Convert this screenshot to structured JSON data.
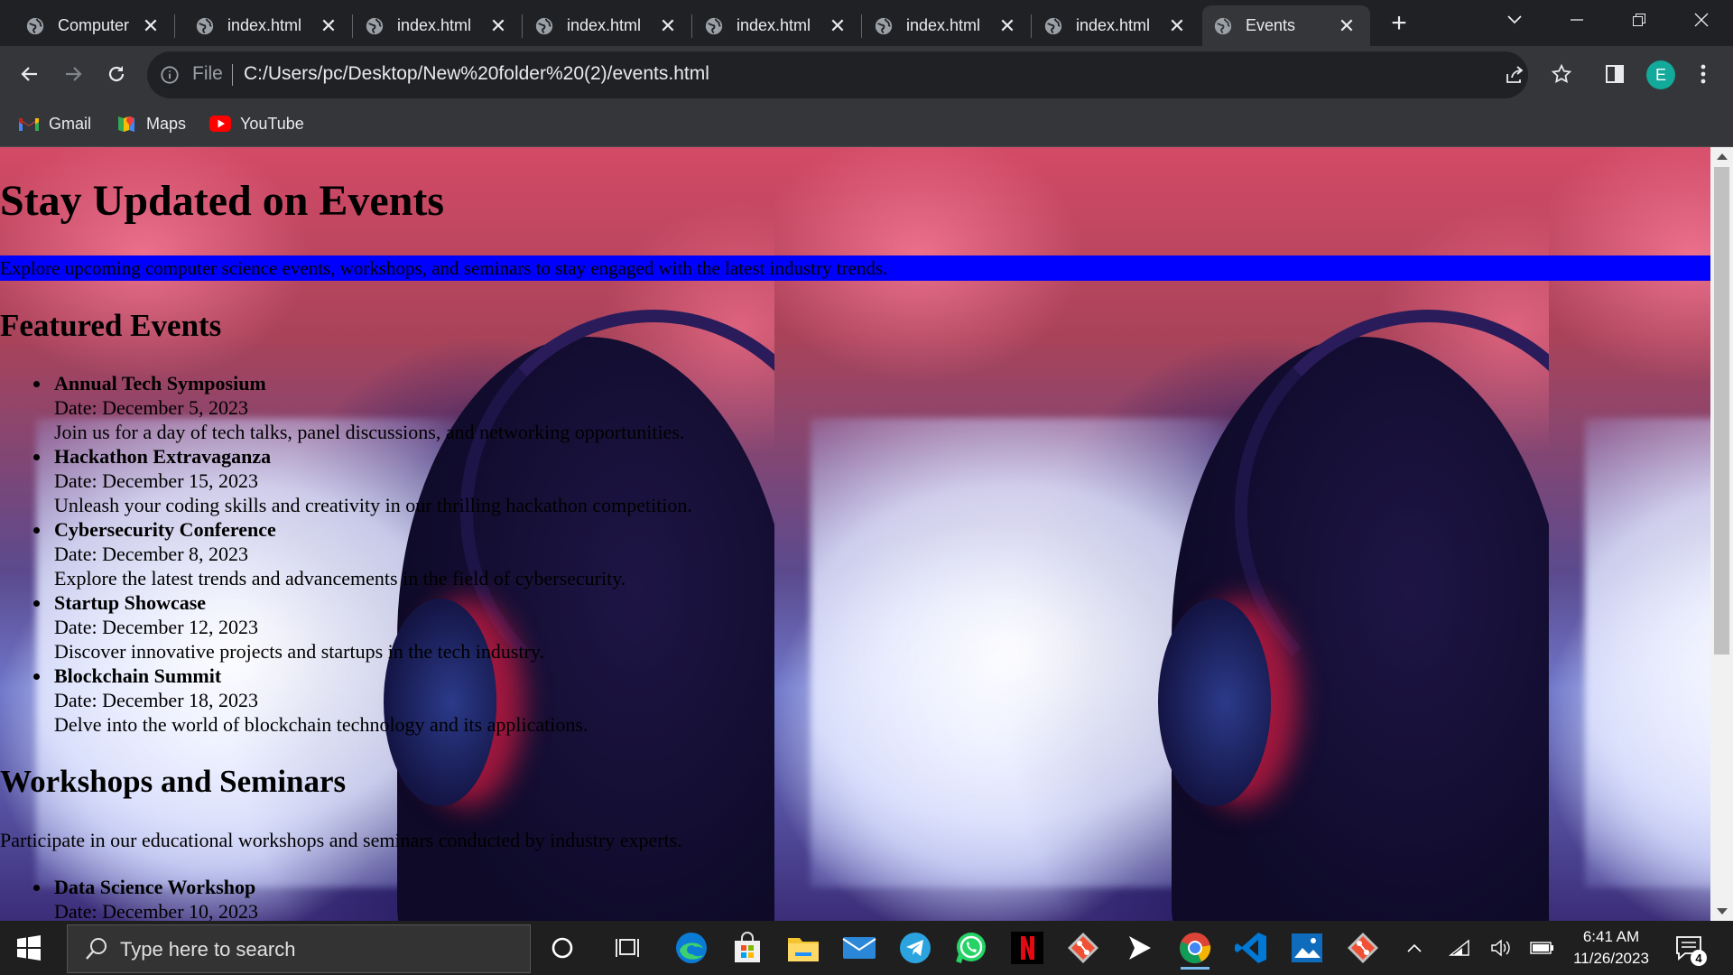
{
  "browser": {
    "tabs": [
      {
        "title": "Computer",
        "active": false
      },
      {
        "title": "index.html",
        "active": false
      },
      {
        "title": "index.html",
        "active": false
      },
      {
        "title": "index.html",
        "active": false
      },
      {
        "title": "index.html",
        "active": false
      },
      {
        "title": "index.html",
        "active": false
      },
      {
        "title": "index.html",
        "active": false
      },
      {
        "title": "Events",
        "active": true
      }
    ],
    "address": {
      "scheme_label": "File",
      "url": "C:/Users/pc/Desktop/New%20folder%20(2)/events.html"
    },
    "profile_initial": "E",
    "bookmarks": [
      {
        "label": "Gmail",
        "icon": "gmail-icon"
      },
      {
        "label": "Maps",
        "icon": "maps-icon"
      },
      {
        "label": "YouTube",
        "icon": "youtube-icon"
      }
    ]
  },
  "page": {
    "title": "Stay Updated on Events",
    "intro": "Explore upcoming computer science events, workshops, and seminars to stay engaged with the latest industry trends.",
    "featured": {
      "heading": "Featured Events",
      "events": [
        {
          "title": "Annual Tech Symposium",
          "date": "Date: December 5, 2023",
          "desc": "Join us for a day of tech talks, panel discussions, and networking opportunities."
        },
        {
          "title": "Hackathon Extravaganza",
          "date": "Date: December 15, 2023",
          "desc": "Unleash your coding skills and creativity in our thrilling hackathon competition."
        },
        {
          "title": "Cybersecurity Conference",
          "date": "Date: December 8, 2023",
          "desc": "Explore the latest trends and advancements in the field of cybersecurity."
        },
        {
          "title": "Startup Showcase",
          "date": "Date: December 12, 2023",
          "desc": "Discover innovative projects and startups in the tech industry."
        },
        {
          "title": "Blockchain Summit",
          "date": "Date: December 18, 2023",
          "desc": "Delve into the world of blockchain technology and its applications."
        }
      ]
    },
    "workshops": {
      "heading": "Workshops and Seminars",
      "intro": "Participate in our educational workshops and seminars conducted by industry experts.",
      "items": [
        {
          "title": "Data Science Workshop",
          "date": "Date: December 10, 2023"
        }
      ]
    },
    "colors": {
      "intro_background": "#0000ff"
    }
  },
  "taskbar": {
    "search_placeholder": "Type here to search",
    "apps": [
      "cortana-icon",
      "task-view-icon",
      "edge-icon",
      "store-icon",
      "file-explorer-icon",
      "mail-icon",
      "telegram-icon",
      "whatsapp-icon",
      "netflix-icon",
      "git-icon",
      "media-player-icon",
      "chrome-icon",
      "vscode-icon",
      "photos-icon",
      "git-icon"
    ],
    "time": "6:41 AM",
    "date": "11/26/2023",
    "notification_count": "4"
  }
}
